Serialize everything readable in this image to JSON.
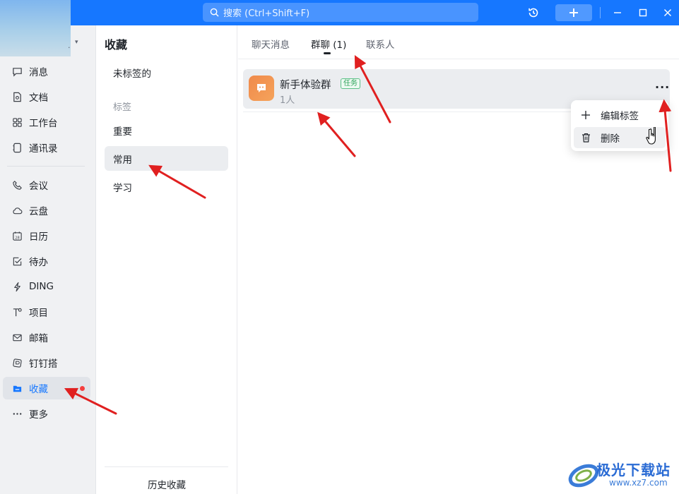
{
  "topbar": {
    "search_placeholder": "搜索 (Ctrl+Shift+F)",
    "avatar_caret": "▾",
    "avatar_dot": "."
  },
  "nav": {
    "items": [
      {
        "label": "消息",
        "icon": "chat-bubble-icon"
      },
      {
        "label": "文档",
        "icon": "document-icon"
      },
      {
        "label": "工作台",
        "icon": "grid-icon"
      },
      {
        "label": "通讯录",
        "icon": "contacts-icon"
      },
      {
        "label": "会议",
        "icon": "phone-icon"
      },
      {
        "label": "云盘",
        "icon": "cloud-icon"
      },
      {
        "label": "日历",
        "icon": "calendar-icon"
      },
      {
        "label": "待办",
        "icon": "todo-icon"
      },
      {
        "label": "DING",
        "icon": "lightning-icon"
      },
      {
        "label": "项目",
        "icon": "project-icon"
      },
      {
        "label": "邮箱",
        "icon": "mail-icon"
      },
      {
        "label": "钉钉搭",
        "icon": "builder-icon"
      },
      {
        "label": "收藏",
        "icon": "folder-icon"
      },
      {
        "label": "更多",
        "icon": "more-icon"
      }
    ],
    "calendar_day": "28",
    "active": "收藏"
  },
  "tags_panel": {
    "title": "收藏",
    "untagged": "未标签的",
    "group_label": "标签",
    "tags": [
      "重要",
      "常用",
      "学习"
    ],
    "active_tag": "常用",
    "history": "历史收藏"
  },
  "main": {
    "tabs": [
      {
        "label": "聊天消息"
      },
      {
        "label": "群聊 (1)"
      },
      {
        "label": "联系人"
      }
    ],
    "active_tab": "群聊 (1)",
    "card": {
      "name": "新手体验群",
      "tag": "任务",
      "sub": "1人",
      "more": "···"
    },
    "menu": {
      "items": [
        {
          "label": "编辑标签",
          "icon": "plus-icon"
        },
        {
          "label": "删除",
          "icon": "trash-icon"
        }
      ]
    }
  },
  "watermark": {
    "text": "极光下载站",
    "url": "www.xz7.com"
  },
  "colors": {
    "accent": "#1677ff",
    "arrow": "#e02020",
    "group_icon": "#f08a4b",
    "tag_green": "#2ea35b",
    "notice_dot": "#f53f3f"
  }
}
